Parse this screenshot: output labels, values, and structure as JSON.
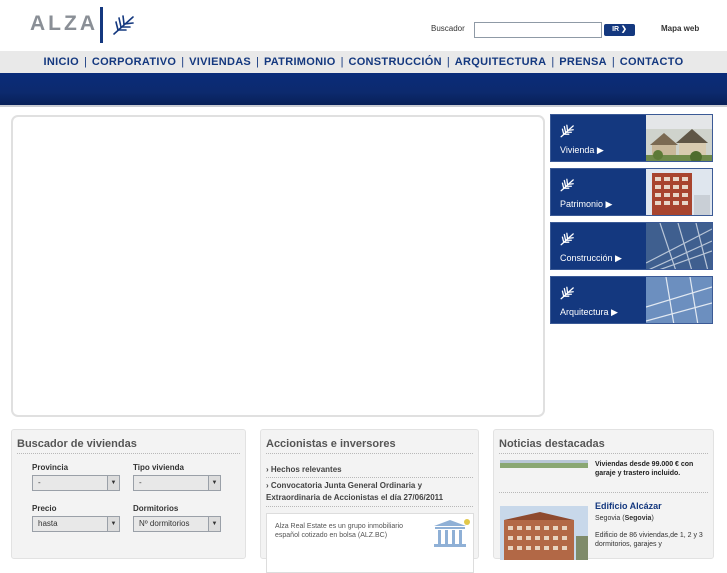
{
  "header": {
    "logo_text": "ALZA",
    "search_label": "Buscador",
    "search_value": "",
    "search_button_label": "IR",
    "sitemap_label": "Mapa web"
  },
  "nav": {
    "items": [
      "INICIO",
      "CORPORATIVO",
      "VIVIENDAS",
      "PATRIMONIO",
      "CONSTRUCCIÓN",
      "ARQUITECTURA",
      "PRENSA",
      "CONTACTO"
    ],
    "separator": "|"
  },
  "side_links": [
    {
      "label": "Vivienda ▶",
      "icon": "leaf-icon",
      "photo": "houses-photo"
    },
    {
      "label": "Patrimonio ▶",
      "icon": "leaf-icon",
      "photo": "building-photo"
    },
    {
      "label": "Construcción ▶",
      "icon": "leaf-icon",
      "photo": "facade-photo"
    },
    {
      "label": "Arquitectura ▶",
      "icon": "leaf-icon",
      "photo": "glass-photo"
    }
  ],
  "search_panel": {
    "title": "Buscador de viviendas",
    "provincia_label": "Provincia",
    "provincia_value": "-",
    "tipo_label": "Tipo vivienda",
    "tipo_value": "-",
    "precio_label": "Precio",
    "precio_value": "hasta",
    "dormitorios_label": "Dormitorios",
    "dormitorios_value": "Nº dormitorios"
  },
  "investors_panel": {
    "title": "Accionistas e inversores",
    "link1": "› Hechos relevantes",
    "link2_line1": "› Convocatoria Junta General Ordinaria y",
    "link2_line2": "Extraordinaria de Accionistas el día 27/06/2011",
    "box_text": "Alza Real Estate es un grupo inmobiliario español cotizado en bolsa (ALZ.BC)"
  },
  "news_panel": {
    "title": "Noticias destacadas",
    "item1_title": "Viviendas desde 99.000 € con garaje y trastero incluido.",
    "item2_title": "Edificio Alcázar",
    "item2_city": "Segovia",
    "item2_province": "Segovia",
    "item2_desc": "Edificio de 86 viviendas,de 1, 2 y 3 dormitorios, garajes y"
  },
  "colors": {
    "brand_blue": "#14387f",
    "nav_band": "#0c2a6e",
    "panel_bg": "#f3f3f3"
  }
}
